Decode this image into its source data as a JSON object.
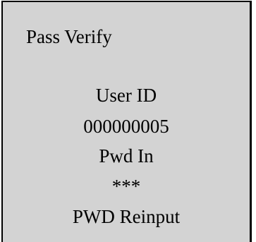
{
  "screen": {
    "title": "Pass Verify",
    "user_id_label": "User ID",
    "user_id_value": "000000005",
    "pwd_label": "Pwd In",
    "pwd_value": "***",
    "status": "PWD Reinput"
  },
  "colors": {
    "background": "#d3d3d3",
    "text": "#000000",
    "border": "#000000"
  }
}
